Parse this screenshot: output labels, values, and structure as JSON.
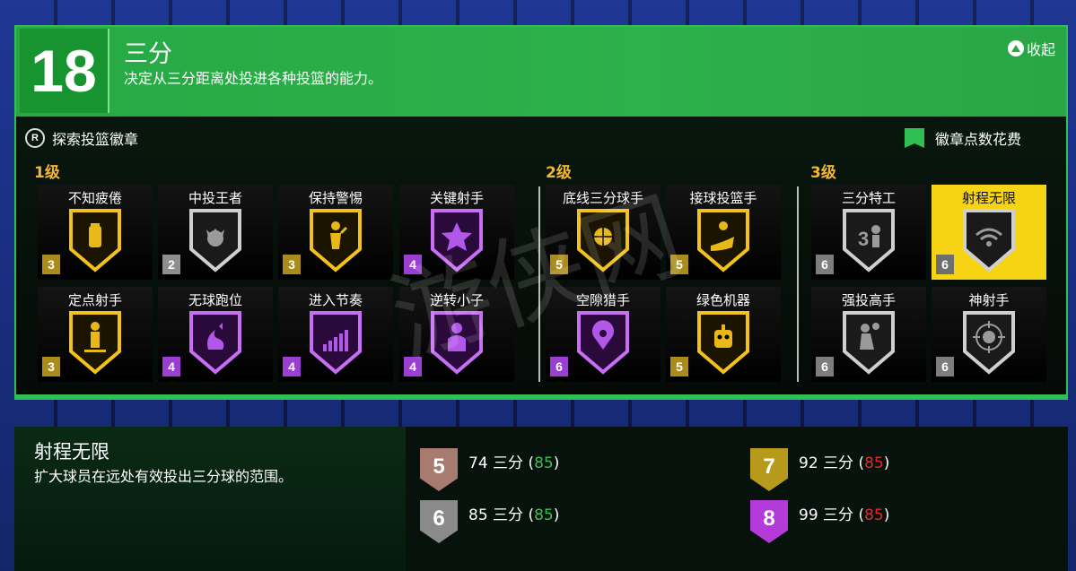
{
  "header": {
    "rating": "18",
    "title": "三分",
    "description": "决定从三分距离处投进各种投篮的能力。",
    "collapse_label": "收起"
  },
  "toolbar": {
    "explore_button_glyph": "R",
    "explore_label": "探索投篮徽章",
    "cost_label": "徽章点数花费"
  },
  "tiers": [
    {
      "label": "1级"
    },
    {
      "label": "2级"
    },
    {
      "label": "3级"
    }
  ],
  "badges": [
    {
      "name": "不知疲倦",
      "level": "3",
      "tier_color": "gold",
      "icon": "energy-drink-icon"
    },
    {
      "name": "中投王者",
      "level": "2",
      "tier_color": "silver",
      "icon": "mid-range-king-icon"
    },
    {
      "name": "保持警惕",
      "level": "3",
      "tier_color": "gold",
      "icon": "alert-shooter-icon"
    },
    {
      "name": "关键射手",
      "level": "4",
      "tier_color": "purple",
      "icon": "star-icon"
    },
    {
      "name": "定点射手",
      "level": "3",
      "tier_color": "gold",
      "icon": "spot-shooter-icon"
    },
    {
      "name": "无球跑位",
      "level": "4",
      "tier_color": "purple",
      "icon": "fox-icon"
    },
    {
      "name": "进入节奏",
      "level": "4",
      "tier_color": "purple",
      "icon": "rhythm-bars-icon"
    },
    {
      "name": "逆转小子",
      "level": "4",
      "tier_color": "purple",
      "icon": "comeback-player-icon"
    },
    {
      "name": "底线三分球手",
      "level": "5",
      "tier_color": "gold",
      "icon": "corner-basketball-icon"
    },
    {
      "name": "接球投篮手",
      "level": "5",
      "tier_color": "gold",
      "icon": "catch-shoot-hand-icon"
    },
    {
      "name": "空隙猎手",
      "level": "6",
      "tier_color": "purple",
      "icon": "location-pin-icon"
    },
    {
      "name": "绿色机器",
      "level": "5",
      "tier_color": "gold",
      "icon": "robot-icon"
    },
    {
      "name": "三分特工",
      "level": "6",
      "tier_color": "silver",
      "icon": "three-agent-icon"
    },
    {
      "name": "射程无限",
      "level": "6",
      "tier_color": "silver",
      "icon": "wifi-range-icon",
      "selected": true
    },
    {
      "name": "强投高手",
      "level": "6",
      "tier_color": "silver",
      "icon": "hard-shot-icon"
    },
    {
      "name": "神射手",
      "level": "6",
      "tier_color": "silver",
      "icon": "skull-crosshair-icon"
    }
  ],
  "detail": {
    "name": "射程无限",
    "description": "扩大球员在远处有效投出三分球的范围。",
    "requirements": [
      {
        "level": "5",
        "color": "#a77b6f",
        "text": "74 三分 (",
        "value": "85",
        "value_status": "met",
        "close": ")"
      },
      {
        "level": "6",
        "color": "#8a8a8a",
        "text": "85 三分 (",
        "value": "85",
        "value_status": "met",
        "close": ")"
      },
      {
        "level": "7",
        "color": "#b79a1c",
        "text": "92 三分 (",
        "value": "85",
        "value_status": "unmet",
        "close": ")"
      },
      {
        "level": "8",
        "color": "#b53bd8",
        "text": "99 三分 (",
        "value": "85",
        "value_status": "unmet",
        "close": ")"
      }
    ]
  },
  "colors": {
    "accent_green": "#2fbf52",
    "tier_gold": "#f2b630",
    "selected_yellow": "#f6d313",
    "met": "#3dbd54",
    "unmet": "#e02a2a"
  }
}
